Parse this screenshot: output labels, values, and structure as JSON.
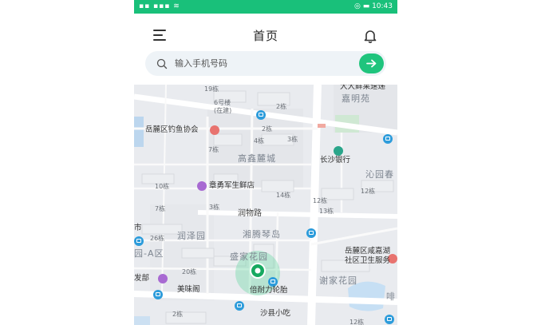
{
  "status_bar": {
    "time": "10:43"
  },
  "header": {
    "menu_icon": "menu-icon",
    "title": "首页",
    "bell_icon": "bell-icon"
  },
  "search": {
    "placeholder": "输入手机号码",
    "search_icon": "search-icon",
    "go_icon": "arrow-right-icon",
    "accent_color": "#1fc47d"
  },
  "map": {
    "labels": {
      "l19": "19栋",
      "store": "大大鲜果速递",
      "building6": "6号楼",
      "building6_sub": "(在建)",
      "l2a": "2栋",
      "jiamingyuan": "嘉明苑",
      "fishing": "岳麓区钓鱼协会",
      "l2b": "2栋",
      "l4": "4栋",
      "l3a": "3栋",
      "l7a": "7栋",
      "gaoxin": "高鑫麓城",
      "bank": "长沙银行",
      "qinyuan": "沁园春",
      "l10": "10栋",
      "fresh": "章勇军生鲜店",
      "l14": "14栋",
      "l12a": "12栋",
      "l12b": "12栋",
      "l7b": "7栋",
      "l3b": "3栋",
      "runwu": "润物路",
      "l13": "13栋",
      "shi": "市",
      "l26": "26栋",
      "runze": "润泽园",
      "xiangteng": "湘腾琴岛",
      "quA": "园-A区",
      "shengjia": "盛家花园",
      "health": "岳麓区咸嘉湖",
      "health2": "社区卫生服务",
      "l20": "20栋",
      "fafa": "发部",
      "xiejia": "谢家花园",
      "meiweige": "美味阁",
      "tire": "倍耐力轮胎",
      "shaxian": "沙县小吃",
      "l2c": "2栋",
      "l12c": "12栋",
      "hua": "啡"
    }
  }
}
